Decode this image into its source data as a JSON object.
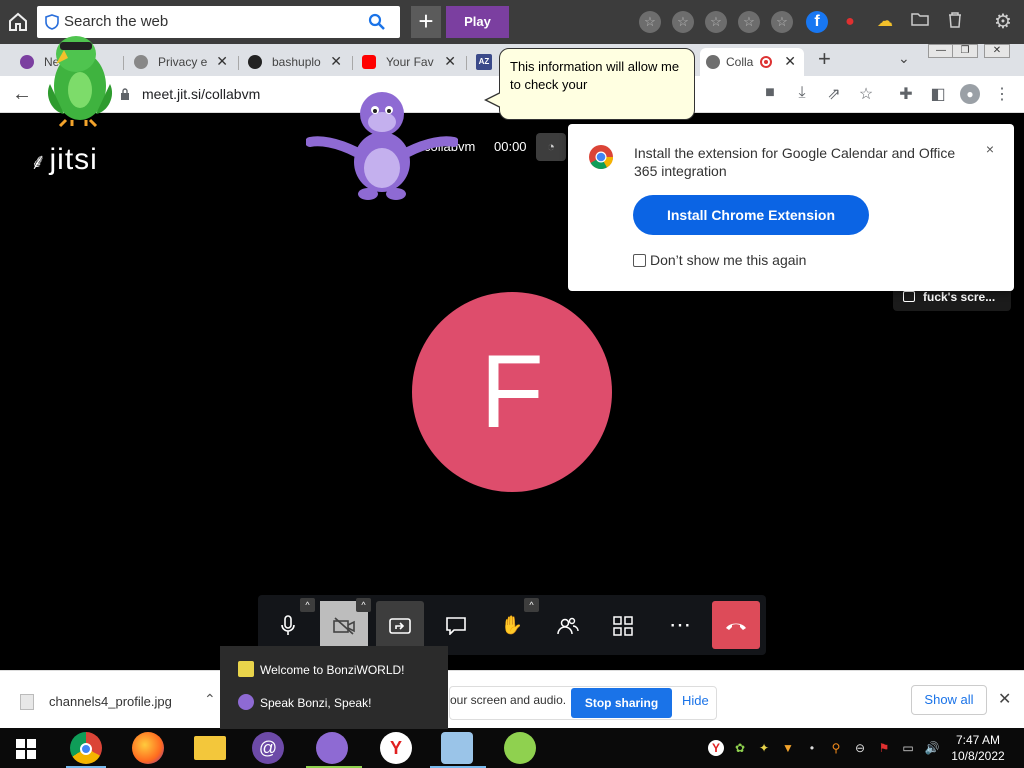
{
  "toolbar": {
    "search_placeholder": "Search the web",
    "play_label": "Play",
    "plus_label": "+"
  },
  "tabs": [
    {
      "label": "Ne",
      "icon": "at-icon",
      "color": "#7b3fa0"
    },
    {
      "label": "Privacy e",
      "icon": "privacy-icon",
      "color": "#888888"
    },
    {
      "label": "bashuplo",
      "icon": "cloud-upload-icon",
      "color": "#222222"
    },
    {
      "label": "Your Fav",
      "icon": "youtube-icon",
      "color": "#ff0000"
    },
    {
      "label": "AZ",
      "icon": "az-icon",
      "color": "#3b4a8a"
    },
    {
      "label": "Colla",
      "icon": "jitsi-icon",
      "color": "#444444",
      "active": true
    }
  ],
  "address": {
    "url": "meet.jit.si/collabvm"
  },
  "bubble": {
    "text": "This information will allow me to check your"
  },
  "meeting": {
    "logo_text": "jitsi",
    "name": "collabvm",
    "timer": "00:00",
    "avatar_letter": "F",
    "avatar_color": "#de4d6c",
    "thumb_label": "fuck's scre..."
  },
  "extension_popup": {
    "message": "Install the extension for Google Calendar and Office 365 integration",
    "close": "×",
    "install_label": "Install Chrome Extension",
    "checkbox_label": "Don’t show me this again"
  },
  "meeting_toolbar": {
    "buttons": [
      "mic",
      "camera",
      "share-screen",
      "chat",
      "raise-hand",
      "participants",
      "tile-view",
      "more",
      "hangup"
    ]
  },
  "download_bar": {
    "file_name": "channels4_profile.jpg",
    "share_text": "our screen and audio.",
    "stop_label": "Stop sharing",
    "hide_label": "Hide",
    "show_all_label": "Show all",
    "close": "✕"
  },
  "bonzi_panel": {
    "items": [
      {
        "label": "Welcome to BonziWORLD!",
        "icon": "banana-icon"
      },
      {
        "label": "Speak Bonzi, Speak!",
        "icon": "bonzi-icon"
      }
    ]
  },
  "taskbar": {
    "time": "7:47 AM",
    "date": "10/8/2022"
  }
}
